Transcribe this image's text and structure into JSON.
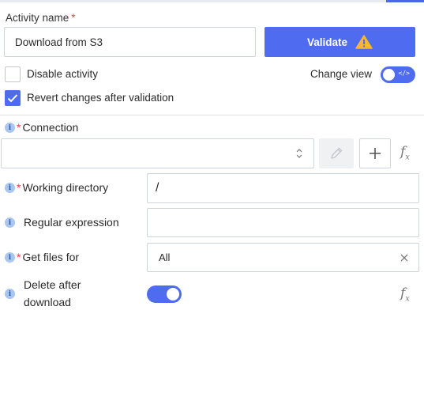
{
  "activity": {
    "label": "Activity name",
    "required_mark": "*",
    "name_value": "Download from S3",
    "validate_label": "Validate"
  },
  "options": {
    "disable_activity_label": "Disable activity",
    "disable_activity_checked": false,
    "revert_changes_label": "Revert changes after validation",
    "revert_changes_checked": true,
    "change_view_label": "Change view",
    "change_view_toggle_icon": "</>",
    "change_view_on": true
  },
  "fields": {
    "info_icon_glyph": "i",
    "connection": {
      "label": "Connection",
      "required_mark": "*",
      "value": ""
    },
    "working_directory": {
      "label": "Working directory",
      "required_mark": "*",
      "value": "/"
    },
    "regular_expression": {
      "label": "Regular expression",
      "value": ""
    },
    "get_files_for": {
      "label": "Get files for",
      "required_mark": "*",
      "value": "All"
    },
    "delete_after_download": {
      "label_line1": "Delete after",
      "label_line2": "download",
      "enabled": true
    }
  },
  "colors": {
    "accent": "#4f6cf0",
    "required": "#e0453a",
    "warning": "#f5b731",
    "info_icon_bg": "#a9c6ee"
  },
  "icons": [
    "warning-icon",
    "check-icon",
    "code-icon",
    "info-icon",
    "chevron-updown-icon",
    "pencil-icon",
    "plus-icon",
    "function-icon",
    "close-icon"
  ]
}
